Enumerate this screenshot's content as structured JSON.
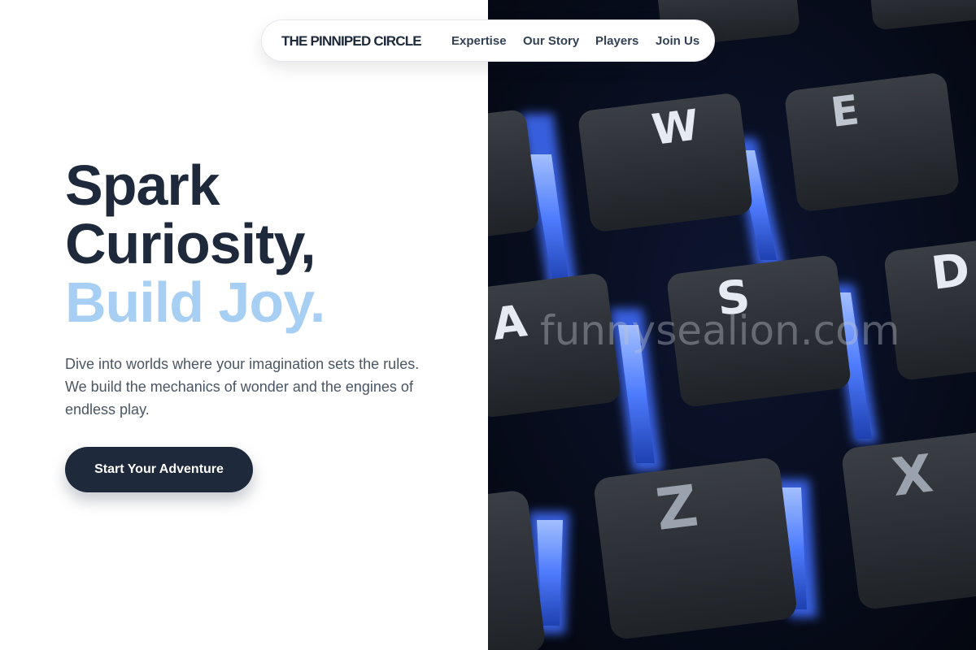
{
  "nav": {
    "brand": "THE PINNIPED CIRCLE",
    "links": [
      {
        "label": "Expertise"
      },
      {
        "label": "Our Story"
      },
      {
        "label": "Players"
      },
      {
        "label": "Join Us"
      }
    ]
  },
  "hero": {
    "title_line1": "Spark",
    "title_line2": "Curiosity,",
    "title_accent": "Build Joy.",
    "description": "Dive into worlds where your imagination sets the rules. We build the mechanics of wonder and the engines of endless play.",
    "cta_label": "Start Your Adventure"
  },
  "image": {
    "subject": "backlit-keyboard-keys",
    "keys": [
      "W",
      "E",
      "A",
      "S",
      "D",
      "Z",
      "X"
    ]
  },
  "watermark": "funnysealion.com",
  "colors": {
    "primary": "#1e293b",
    "accent": "#a7cef3",
    "text_muted": "#4b5563",
    "glow": "#5b8cff"
  }
}
